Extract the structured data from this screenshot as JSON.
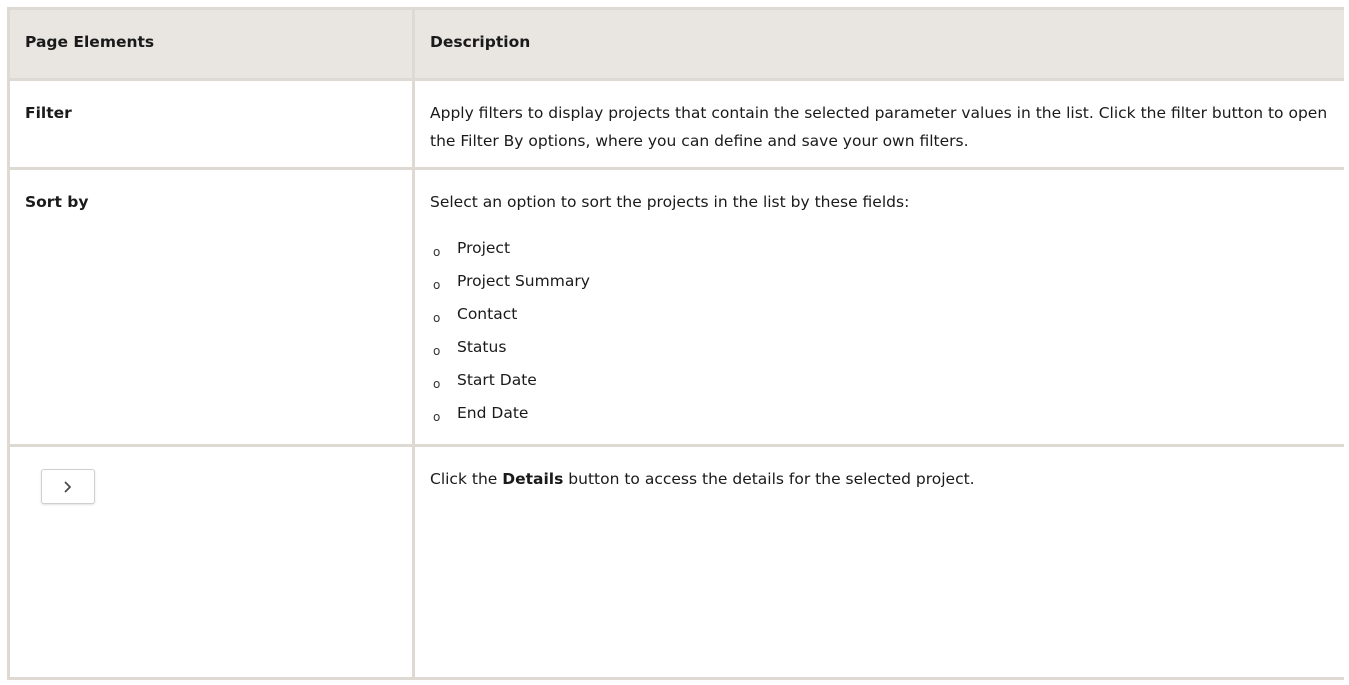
{
  "table": {
    "headers": {
      "elements": "Page Elements",
      "description": "Description"
    },
    "rows": [
      {
        "element": "Filter",
        "description": "Apply filters to display projects that contain the selected parameter values in the list. Click the filter button to open the Filter By options, where you can define and save your own filters."
      },
      {
        "element": "Sort by",
        "description": "Select an option to sort the projects in the list by these fields:",
        "options": [
          "Project",
          "Project Summary",
          "Contact",
          "Status",
          "Start Date",
          "End Date"
        ]
      },
      {
        "element_icon": "chevron-right-icon",
        "description_before": "Click the",
        "description_bold": "Details",
        "description_after": "button to access the details for the selected project."
      }
    ]
  },
  "bullet_glyph": "o"
}
